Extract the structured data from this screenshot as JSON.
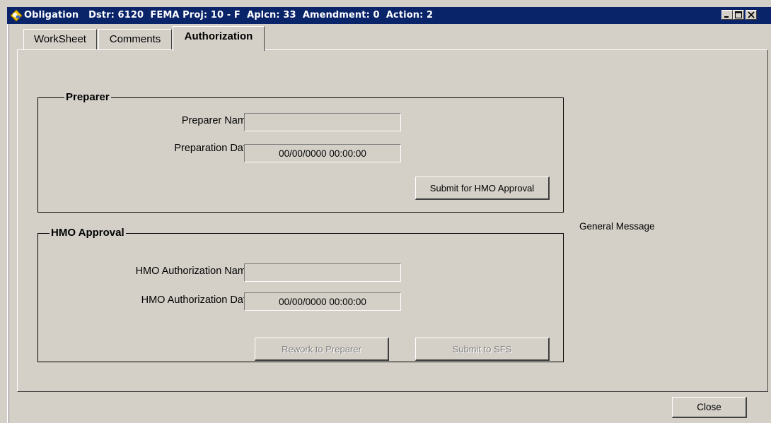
{
  "window": {
    "title": "Obligation   Dstr: 6120  FEMA Proj: 10 - F  Aplcn: 33  Amendment: 0  Action: 2",
    "icon": "fema-app-icon",
    "controls": [
      "minimize-icon",
      "maximize-icon",
      "close-icon"
    ]
  },
  "tabs": [
    {
      "label": "WorkSheet",
      "active": false
    },
    {
      "label": "Comments",
      "active": false
    },
    {
      "label": "Authorization",
      "active": true
    }
  ],
  "preparer": {
    "title": "Preparer",
    "name_label": "Preparer Name:",
    "name_value": "",
    "date_label": "Preparation Date:",
    "date_value": "00/00/0000 00:00:00",
    "submit_button": "Submit for HMO Approval"
  },
  "hmo": {
    "title": "HMO Approval",
    "name_label": "HMO Authorization Name:",
    "name_value": "",
    "date_label": "HMO Authorization Date:",
    "date_value": "00/00/0000 00:00:00",
    "rework_button": "Rework to Preparer",
    "submit_sfs_button": "Submit to SFS"
  },
  "general_message": "General Message",
  "close_button": "Close",
  "colors": {
    "titlebar": "#0a246a",
    "face": "#d4d0c8",
    "disabled_text": "#808080"
  }
}
